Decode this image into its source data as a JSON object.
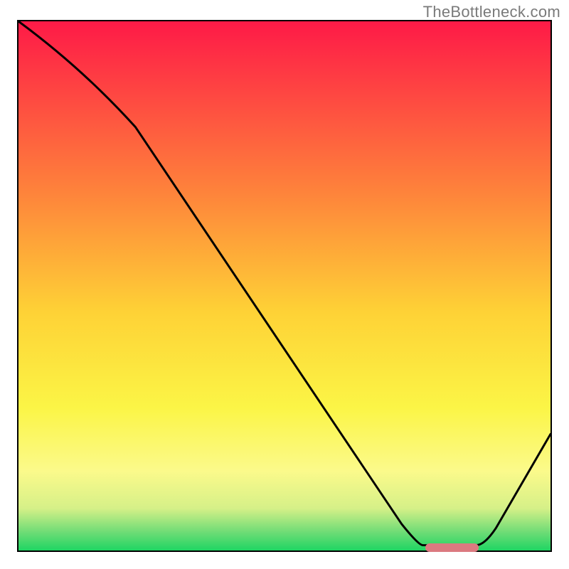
{
  "watermark": "TheBottleneck.com",
  "colors": {
    "top": "#fe1a47",
    "mid_red_orange": "#fe6e3e",
    "mid_orange": "#fea43a",
    "mid_yellow": "#fde635",
    "lower_yellow": "#fbf85f",
    "pale_green": "#c0ea78",
    "green": "#1fd563",
    "line": "#000000",
    "border": "#000000",
    "marker": "#db7a80"
  },
  "chart_data": {
    "type": "line",
    "title": "",
    "xlabel": "",
    "ylabel": "",
    "xlim": [
      0,
      100
    ],
    "ylim": [
      0,
      100
    ],
    "x": [
      0,
      22,
      76,
      86,
      100
    ],
    "values": [
      100,
      80,
      1,
      1,
      22
    ],
    "optimal_range_x": [
      76,
      86
    ],
    "series": [
      {
        "name": "bottleneck-curve",
        "x": [
          0,
          22,
          76,
          86,
          100
        ],
        "y": [
          100,
          80,
          1,
          1,
          22
        ]
      }
    ],
    "background_gradient_stops": [
      {
        "offset": 0,
        "color": "#fe1a47"
      },
      {
        "offset": 32,
        "color": "#fe823b"
      },
      {
        "offset": 55,
        "color": "#fed236"
      },
      {
        "offset": 73,
        "color": "#fbf546"
      },
      {
        "offset": 85,
        "color": "#fbfa8b"
      },
      {
        "offset": 92,
        "color": "#d6f088"
      },
      {
        "offset": 96.5,
        "color": "#6fdc76"
      },
      {
        "offset": 100,
        "color": "#1fd563"
      }
    ]
  }
}
